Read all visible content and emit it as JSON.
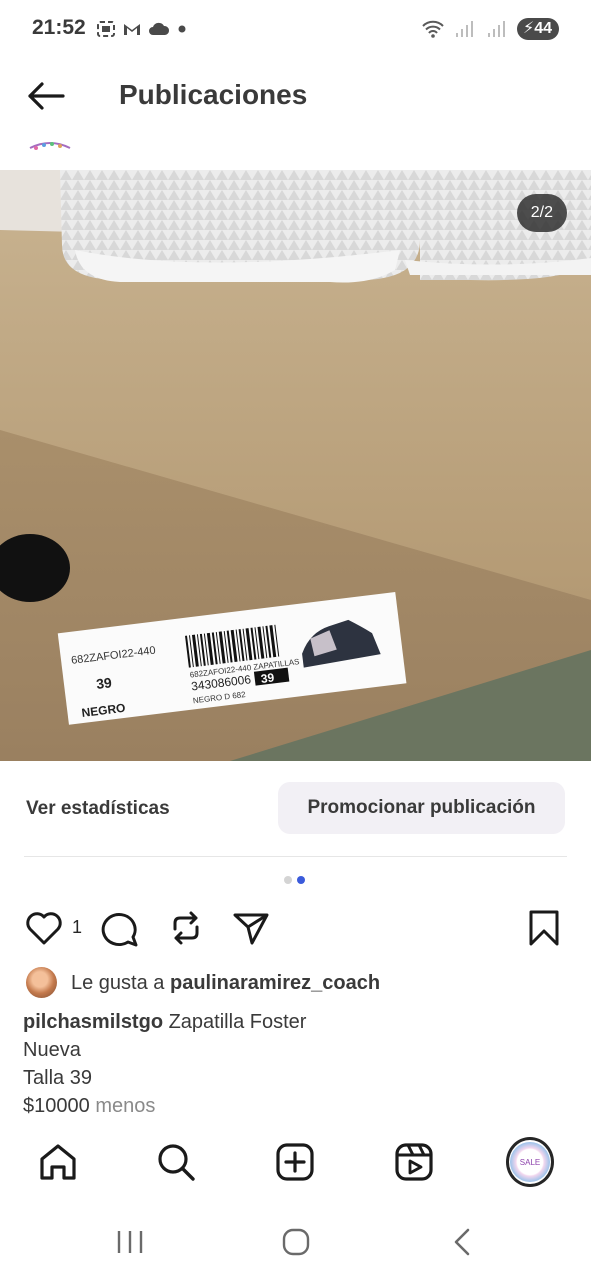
{
  "status_bar": {
    "time": "21:52",
    "battery": "44"
  },
  "header": {
    "title": "Publicaciones"
  },
  "post": {
    "counter": "2/2",
    "label": {
      "code": "682ZAFOI22-440",
      "size": "39",
      "color": "NEGRO",
      "line1": "682ZAFOI22-440 ZAPATILLAS",
      "barcode_number": "343086006",
      "size_box": "39",
      "line3": "NEGRO   D 682"
    }
  },
  "actions": {
    "stats_label": "Ver estadísticas",
    "promote_label": "Promocionar publicación"
  },
  "carousel": {
    "total": 2,
    "active_index": 2
  },
  "engagement": {
    "like_count": "1"
  },
  "likes": {
    "prefix": "Le gusta a",
    "user": "paulinaramirez_coach"
  },
  "caption": {
    "username": "pilchasmilstgo",
    "line1": "Zapatilla Foster",
    "line2": "Nueva",
    "line3": "Talla 39",
    "line4": "$10000",
    "more": "menos"
  },
  "profile": {
    "badge_text": "SALE"
  },
  "colors": {
    "accent_dot": "#3b5bdb",
    "promote_bg": "#f2f0f5",
    "text_primary": "#262626"
  }
}
